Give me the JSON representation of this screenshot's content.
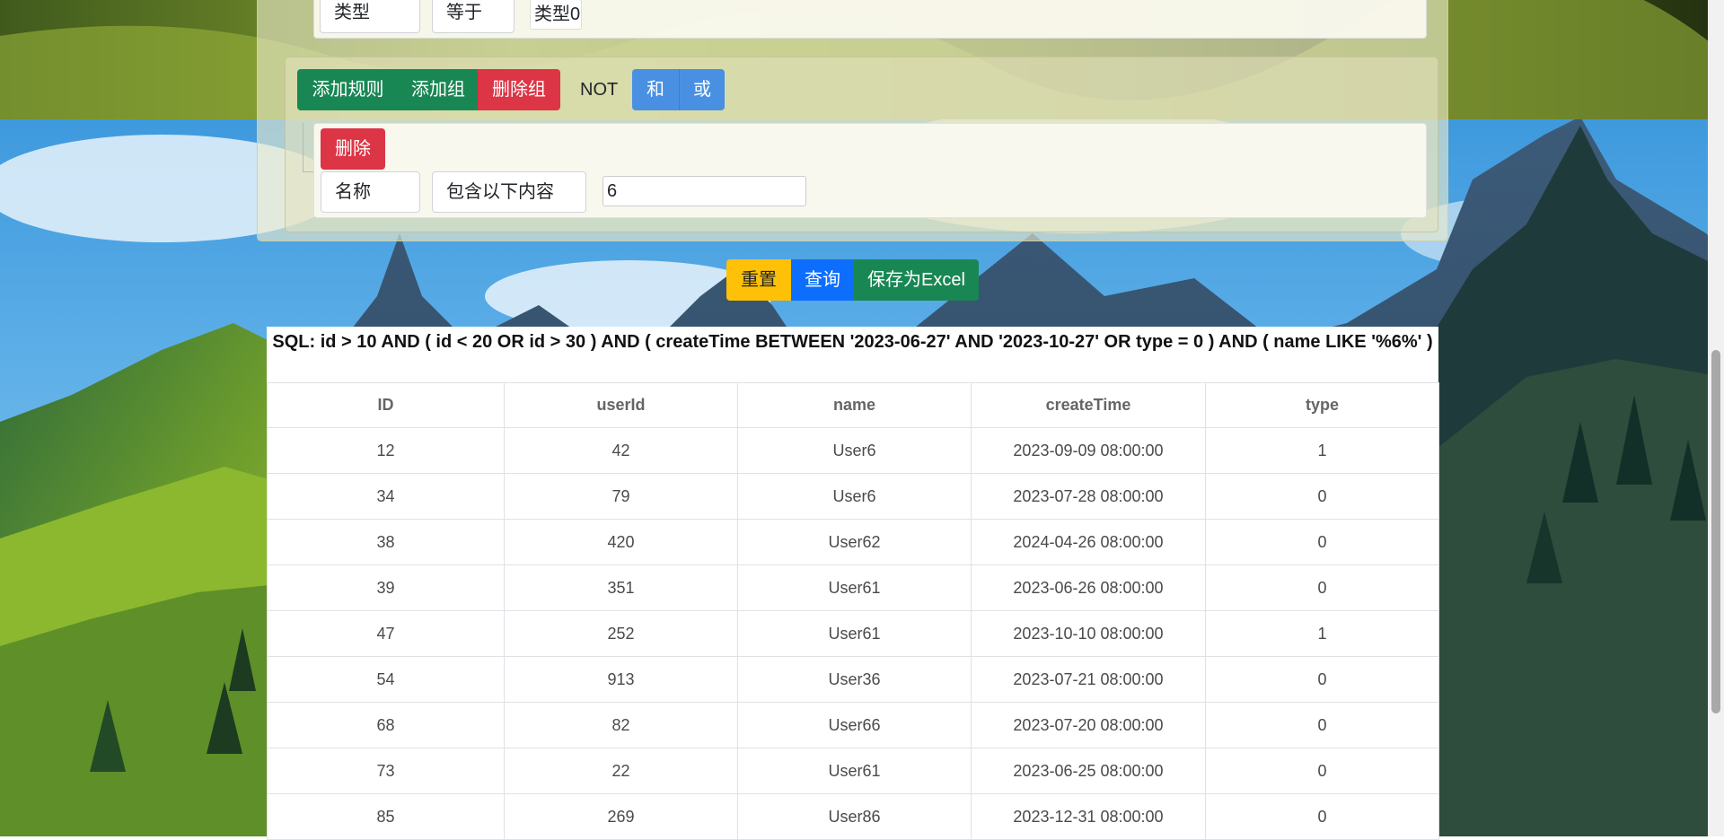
{
  "query_builder": {
    "top_rule": {
      "field": "类型",
      "operator": "等于",
      "value": "类型0"
    },
    "group": {
      "add_rule_label": "添加规则",
      "add_group_label": "添加组",
      "delete_group_label": "删除组",
      "not_label": "NOT",
      "and_label": "和",
      "or_label": "或"
    },
    "rule": {
      "delete_label": "删除",
      "field": "名称",
      "operator": "包含以下内容",
      "value": "6"
    }
  },
  "actions": {
    "reset": "重置",
    "query": "查询",
    "save_excel": "保存为Excel"
  },
  "sql": "SQL:  id > 10 AND ( id < 20 OR id > 30 ) AND ( createTime BETWEEN '2023-06-27' AND '2023-10-27' OR type = 0 ) AND ( name LIKE '%6%' )",
  "table": {
    "headers": [
      "ID",
      "userId",
      "name",
      "createTime",
      "type"
    ],
    "rows": [
      [
        "12",
        "42",
        "User6",
        "2023-09-09 08:00:00",
        "1"
      ],
      [
        "34",
        "79",
        "User6",
        "2023-07-28 08:00:00",
        "0"
      ],
      [
        "38",
        "420",
        "User62",
        "2024-04-26 08:00:00",
        "0"
      ],
      [
        "39",
        "351",
        "User61",
        "2023-06-26 08:00:00",
        "0"
      ],
      [
        "47",
        "252",
        "User61",
        "2023-10-10 08:00:00",
        "1"
      ],
      [
        "54",
        "913",
        "User36",
        "2023-07-21 08:00:00",
        "0"
      ],
      [
        "68",
        "82",
        "User66",
        "2023-07-20 08:00:00",
        "0"
      ],
      [
        "73",
        "22",
        "User61",
        "2023-06-25 08:00:00",
        "0"
      ],
      [
        "85",
        "269",
        "User86",
        "2023-12-31 08:00:00",
        "0"
      ]
    ]
  },
  "colors": {
    "success": "#198754",
    "danger": "#dc3545",
    "connector_blue": "#4a90e2",
    "warning": "#ffc107",
    "primary": "#0d6efd"
  }
}
